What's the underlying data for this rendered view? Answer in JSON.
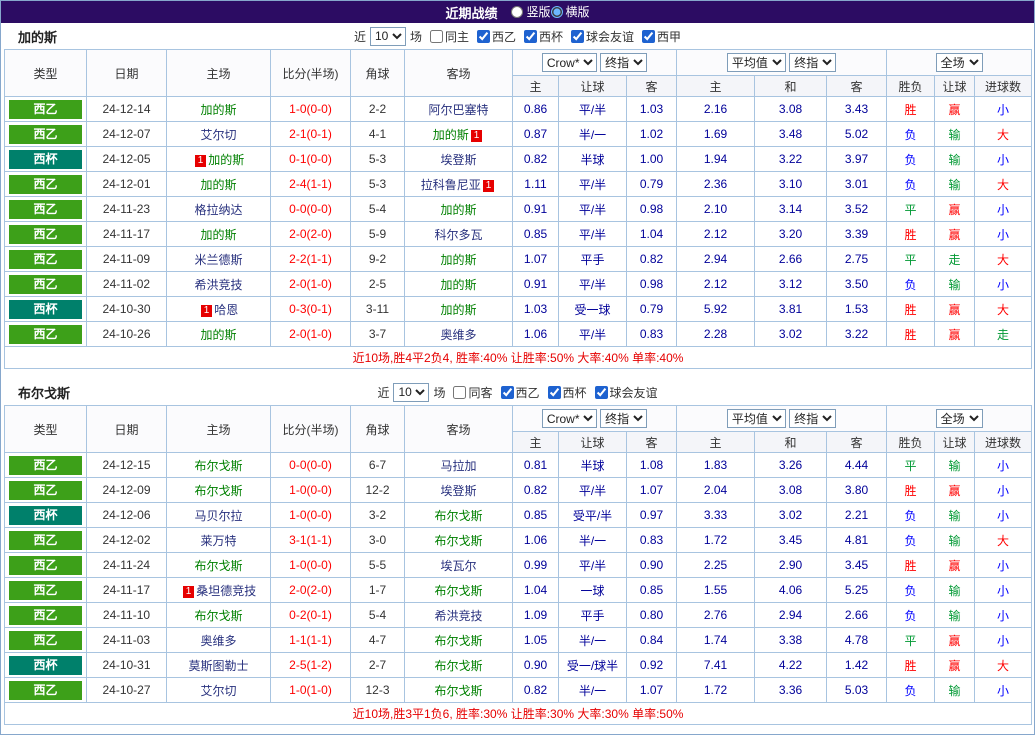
{
  "titlebar": {
    "title": "近期战绩",
    "options": [
      {
        "label": "竖版",
        "checked": false
      },
      {
        "label": "横版",
        "checked": true
      }
    ]
  },
  "filter_labels": {
    "near": "近",
    "matches": "场"
  },
  "table_header": {
    "type": "类型",
    "date": "日期",
    "home": "主场",
    "score": "比分(半场)",
    "corner": "角球",
    "away": "客场",
    "group1_select1": "Crow*",
    "group1_select2": "终指",
    "group1_cols": [
      "主",
      "让球",
      "客"
    ],
    "group2_select1": "平均值",
    "group2_select2": "终指",
    "group2_cols": [
      "主",
      "和",
      "客"
    ],
    "group3_select1": "全场",
    "group3_cols": [
      "胜负",
      "让球",
      "进球数"
    ]
  },
  "colors": {
    "titlebar_bg": "#2c0c63",
    "border": "#a8c4e0",
    "liga2_green": "#3da019",
    "cup_teal": "#00806b",
    "focus_team": "#008000",
    "score_red": "#ff0000",
    "odds_navy": "#000099",
    "win_red": "#ff0000",
    "lose_blue": "#0000ff",
    "draw_green": "#009933"
  },
  "sections": [
    {
      "team": "加的斯",
      "count": "10",
      "checkboxes": [
        {
          "label": "同主",
          "checked": false
        },
        {
          "label": "西乙",
          "checked": true
        },
        {
          "label": "西杯",
          "checked": true
        },
        {
          "label": "球会友谊",
          "checked": true
        },
        {
          "label": "西甲",
          "checked": true
        }
      ],
      "rows": [
        {
          "league": "西乙",
          "date": "24-12-14",
          "home": {
            "name": "加的斯",
            "focus": true,
            "card": "",
            "card_pos": ""
          },
          "score": "1-0(0-0)",
          "corner": "2-2",
          "away": {
            "name": "阿尔巴塞特",
            "focus": false,
            "card": "",
            "card_pos": ""
          },
          "odds": [
            "0.86",
            "平/半",
            "1.03",
            "2.16",
            "3.08",
            "3.43"
          ],
          "results": [
            "胜",
            "赢",
            "小"
          ]
        },
        {
          "league": "西乙",
          "date": "24-12-07",
          "home": {
            "name": "艾尔切",
            "focus": false,
            "card": "",
            "card_pos": ""
          },
          "score": "2-1(0-1)",
          "corner": "4-1",
          "away": {
            "name": "加的斯",
            "focus": true,
            "card": "1",
            "card_pos": "right"
          },
          "odds": [
            "0.87",
            "半/一",
            "1.02",
            "1.69",
            "3.48",
            "5.02"
          ],
          "results": [
            "负",
            "输",
            "大"
          ]
        },
        {
          "league": "西杯",
          "date": "24-12-05",
          "home": {
            "name": "加的斯",
            "focus": true,
            "card": "1",
            "card_pos": "left"
          },
          "score": "0-1(0-0)",
          "corner": "5-3",
          "away": {
            "name": "埃登斯",
            "focus": false,
            "card": "",
            "card_pos": ""
          },
          "odds": [
            "0.82",
            "半球",
            "1.00",
            "1.94",
            "3.22",
            "3.97"
          ],
          "results": [
            "负",
            "输",
            "小"
          ]
        },
        {
          "league": "西乙",
          "date": "24-12-01",
          "home": {
            "name": "加的斯",
            "focus": true,
            "card": "",
            "card_pos": ""
          },
          "score": "2-4(1-1)",
          "corner": "5-3",
          "away": {
            "name": "拉科鲁尼亚",
            "focus": false,
            "card": "1",
            "card_pos": "right"
          },
          "odds": [
            "1.11",
            "平/半",
            "0.79",
            "2.36",
            "3.10",
            "3.01"
          ],
          "results": [
            "负",
            "输",
            "大"
          ]
        },
        {
          "league": "西乙",
          "date": "24-11-23",
          "home": {
            "name": "格拉纳达",
            "focus": false,
            "card": "",
            "card_pos": ""
          },
          "score": "0-0(0-0)",
          "corner": "5-4",
          "away": {
            "name": "加的斯",
            "focus": true,
            "card": "",
            "card_pos": ""
          },
          "odds": [
            "0.91",
            "平/半",
            "0.98",
            "2.10",
            "3.14",
            "3.52"
          ],
          "results": [
            "平",
            "赢",
            "小"
          ]
        },
        {
          "league": "西乙",
          "date": "24-11-17",
          "home": {
            "name": "加的斯",
            "focus": true,
            "card": "",
            "card_pos": ""
          },
          "score": "2-0(2-0)",
          "corner": "5-9",
          "away": {
            "name": "科尔多瓦",
            "focus": false,
            "card": "",
            "card_pos": ""
          },
          "odds": [
            "0.85",
            "平/半",
            "1.04",
            "2.12",
            "3.20",
            "3.39"
          ],
          "results": [
            "胜",
            "赢",
            "小"
          ]
        },
        {
          "league": "西乙",
          "date": "24-11-09",
          "home": {
            "name": "米兰德斯",
            "focus": false,
            "card": "",
            "card_pos": ""
          },
          "score": "2-2(1-1)",
          "corner": "9-2",
          "away": {
            "name": "加的斯",
            "focus": true,
            "card": "",
            "card_pos": ""
          },
          "odds": [
            "1.07",
            "平手",
            "0.82",
            "2.94",
            "2.66",
            "2.75"
          ],
          "results": [
            "平",
            "走",
            "大"
          ]
        },
        {
          "league": "西乙",
          "date": "24-11-02",
          "home": {
            "name": "希洪竞技",
            "focus": false,
            "card": "",
            "card_pos": ""
          },
          "score": "2-0(1-0)",
          "corner": "2-5",
          "away": {
            "name": "加的斯",
            "focus": true,
            "card": "",
            "card_pos": ""
          },
          "odds": [
            "0.91",
            "平/半",
            "0.98",
            "2.12",
            "3.12",
            "3.50"
          ],
          "results": [
            "负",
            "输",
            "小"
          ]
        },
        {
          "league": "西杯",
          "date": "24-10-30",
          "home": {
            "name": "哈恩",
            "focus": false,
            "card": "1",
            "card_pos": "left"
          },
          "score": "0-3(0-1)",
          "corner": "3-11",
          "away": {
            "name": "加的斯",
            "focus": true,
            "card": "",
            "card_pos": ""
          },
          "odds": [
            "1.03",
            "受一球",
            "0.79",
            "5.92",
            "3.81",
            "1.53"
          ],
          "results": [
            "胜",
            "赢",
            "大"
          ]
        },
        {
          "league": "西乙",
          "date": "24-10-26",
          "home": {
            "name": "加的斯",
            "focus": true,
            "card": "",
            "card_pos": ""
          },
          "score": "2-0(1-0)",
          "corner": "3-7",
          "away": {
            "name": "奥维多",
            "focus": false,
            "card": "",
            "card_pos": ""
          },
          "odds": [
            "1.06",
            "平/半",
            "0.83",
            "2.28",
            "3.02",
            "3.22"
          ],
          "results": [
            "胜",
            "赢",
            "走"
          ]
        }
      ],
      "summary": "近10场,胜4平2负4, 胜率:40% 让胜率:50% 大率:40% 单率:40%"
    },
    {
      "team": "布尔戈斯",
      "count": "10",
      "checkboxes": [
        {
          "label": "同客",
          "checked": false
        },
        {
          "label": "西乙",
          "checked": true
        },
        {
          "label": "西杯",
          "checked": true
        },
        {
          "label": "球会友谊",
          "checked": true
        }
      ],
      "rows": [
        {
          "league": "西乙",
          "date": "24-12-15",
          "home": {
            "name": "布尔戈斯",
            "focus": true,
            "card": "",
            "card_pos": ""
          },
          "score": "0-0(0-0)",
          "corner": "6-7",
          "away": {
            "name": "马拉加",
            "focus": false,
            "card": "",
            "card_pos": ""
          },
          "odds": [
            "0.81",
            "半球",
            "1.08",
            "1.83",
            "3.26",
            "4.44"
          ],
          "results": [
            "平",
            "输",
            "小"
          ]
        },
        {
          "league": "西乙",
          "date": "24-12-09",
          "home": {
            "name": "布尔戈斯",
            "focus": true,
            "card": "",
            "card_pos": ""
          },
          "score": "1-0(0-0)",
          "corner": "12-2",
          "away": {
            "name": "埃登斯",
            "focus": false,
            "card": "",
            "card_pos": ""
          },
          "odds": [
            "0.82",
            "平/半",
            "1.07",
            "2.04",
            "3.08",
            "3.80"
          ],
          "results": [
            "胜",
            "赢",
            "小"
          ]
        },
        {
          "league": "西杯",
          "date": "24-12-06",
          "home": {
            "name": "马贝尔拉",
            "focus": false,
            "card": "",
            "card_pos": ""
          },
          "score": "1-0(0-0)",
          "corner": "3-2",
          "away": {
            "name": "布尔戈斯",
            "focus": true,
            "card": "",
            "card_pos": ""
          },
          "odds": [
            "0.85",
            "受平/半",
            "0.97",
            "3.33",
            "3.02",
            "2.21"
          ],
          "results": [
            "负",
            "输",
            "小"
          ]
        },
        {
          "league": "西乙",
          "date": "24-12-02",
          "home": {
            "name": "莱万特",
            "focus": false,
            "card": "",
            "card_pos": ""
          },
          "score": "3-1(1-1)",
          "corner": "3-0",
          "away": {
            "name": "布尔戈斯",
            "focus": true,
            "card": "",
            "card_pos": ""
          },
          "odds": [
            "1.06",
            "半/一",
            "0.83",
            "1.72",
            "3.45",
            "4.81"
          ],
          "results": [
            "负",
            "输",
            "大"
          ]
        },
        {
          "league": "西乙",
          "date": "24-11-24",
          "home": {
            "name": "布尔戈斯",
            "focus": true,
            "card": "",
            "card_pos": ""
          },
          "score": "1-0(0-0)",
          "corner": "5-5",
          "away": {
            "name": "埃瓦尔",
            "focus": false,
            "card": "",
            "card_pos": ""
          },
          "odds": [
            "0.99",
            "平/半",
            "0.90",
            "2.25",
            "2.90",
            "3.45"
          ],
          "results": [
            "胜",
            "赢",
            "小"
          ]
        },
        {
          "league": "西乙",
          "date": "24-11-17",
          "home": {
            "name": "桑坦德竞技",
            "focus": false,
            "card": "1",
            "card_pos": "left"
          },
          "score": "2-0(2-0)",
          "corner": "1-7",
          "away": {
            "name": "布尔戈斯",
            "focus": true,
            "card": "",
            "card_pos": ""
          },
          "odds": [
            "1.04",
            "一球",
            "0.85",
            "1.55",
            "4.06",
            "5.25"
          ],
          "results": [
            "负",
            "输",
            "小"
          ]
        },
        {
          "league": "西乙",
          "date": "24-11-10",
          "home": {
            "name": "布尔戈斯",
            "focus": true,
            "card": "",
            "card_pos": ""
          },
          "score": "0-2(0-1)",
          "corner": "5-4",
          "away": {
            "name": "希洪竞技",
            "focus": false,
            "card": "",
            "card_pos": ""
          },
          "odds": [
            "1.09",
            "平手",
            "0.80",
            "2.76",
            "2.94",
            "2.66"
          ],
          "results": [
            "负",
            "输",
            "小"
          ]
        },
        {
          "league": "西乙",
          "date": "24-11-03",
          "home": {
            "name": "奥维多",
            "focus": false,
            "card": "",
            "card_pos": ""
          },
          "score": "1-1(1-1)",
          "corner": "4-7",
          "away": {
            "name": "布尔戈斯",
            "focus": true,
            "card": "",
            "card_pos": ""
          },
          "odds": [
            "1.05",
            "半/一",
            "0.84",
            "1.74",
            "3.38",
            "4.78"
          ],
          "results": [
            "平",
            "赢",
            "小"
          ]
        },
        {
          "league": "西杯",
          "date": "24-10-31",
          "home": {
            "name": "莫斯图勒士",
            "focus": false,
            "card": "",
            "card_pos": ""
          },
          "score": "2-5(1-2)",
          "corner": "2-7",
          "away": {
            "name": "布尔戈斯",
            "focus": true,
            "card": "",
            "card_pos": ""
          },
          "odds": [
            "0.90",
            "受一/球半",
            "0.92",
            "7.41",
            "4.22",
            "1.42"
          ],
          "results": [
            "胜",
            "赢",
            "大"
          ]
        },
        {
          "league": "西乙",
          "date": "24-10-27",
          "home": {
            "name": "艾尔切",
            "focus": false,
            "card": "",
            "card_pos": ""
          },
          "score": "1-0(1-0)",
          "corner": "12-3",
          "away": {
            "name": "布尔戈斯",
            "focus": true,
            "card": "",
            "card_pos": ""
          },
          "odds": [
            "0.82",
            "半/一",
            "1.07",
            "1.72",
            "3.36",
            "5.03"
          ],
          "results": [
            "负",
            "输",
            "小"
          ]
        }
      ],
      "summary": "近10场,胜3平1负6, 胜率:30% 让胜率:30% 大率:30% 单率:50%"
    }
  ]
}
